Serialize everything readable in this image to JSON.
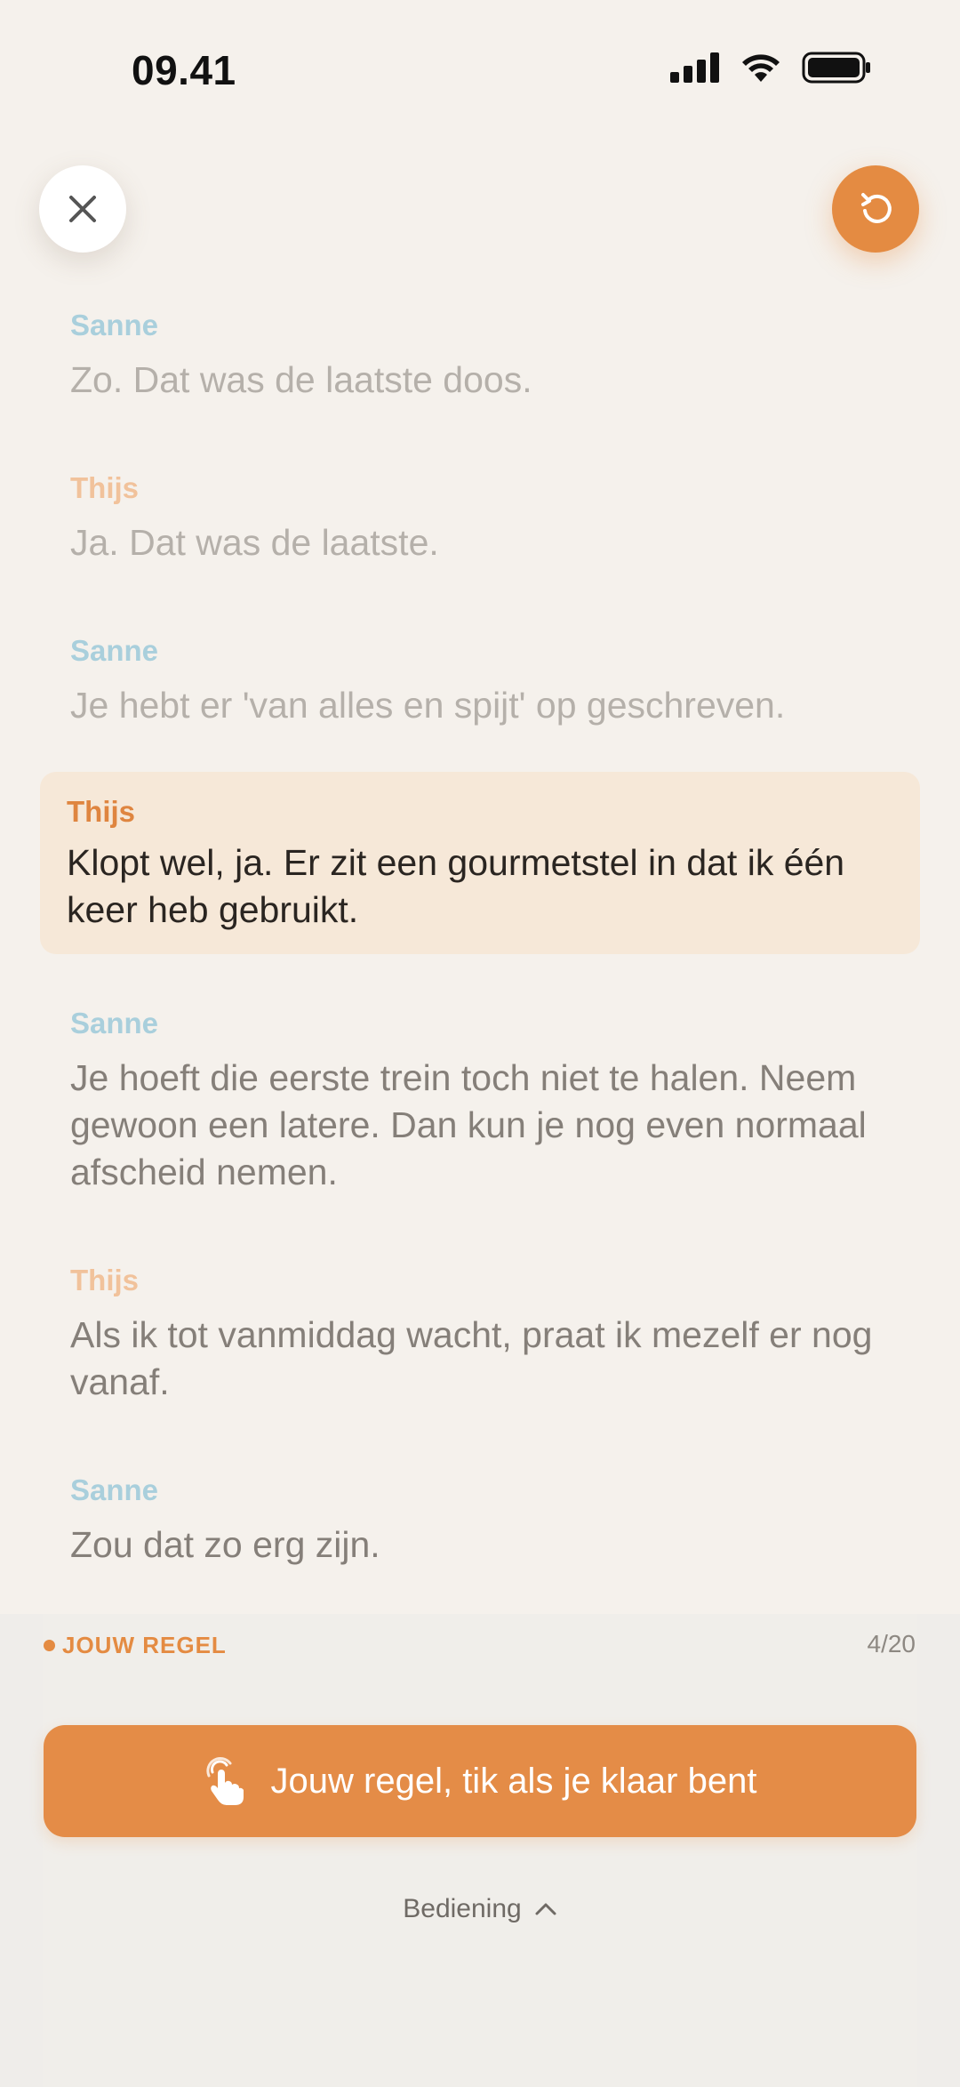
{
  "status_bar": {
    "time": "09.41"
  },
  "top_bar": {
    "close_icon": "close-icon",
    "restart_icon": "restart-icon"
  },
  "script_lines": [
    {
      "speaker": "Sanne",
      "text": "Zo. Dat was de laatste doos."
    },
    {
      "speaker": "Thijs",
      "text": "Ja. Dat was de laatste."
    },
    {
      "speaker": "Sanne",
      "text": "Je hebt er 'van alles en spijt' op geschreven."
    },
    {
      "speaker": "Thijs",
      "text": "Klopt wel, ja. Er zit een gourmetstel in dat ik één keer heb gebruikt."
    },
    {
      "speaker": "Sanne",
      "text": "Je hoeft die eerste trein toch niet te halen. Neem gewoon een latere. Dan kun je nog even normaal afscheid nemen."
    },
    {
      "speaker": "Thijs",
      "text": "Als ik tot vanmiddag wacht, praat ik mezelf er nog vanaf."
    },
    {
      "speaker": "Sanne",
      "text": "Zou dat zo erg zijn."
    }
  ],
  "bottom_panel": {
    "your_line_label": "JOUW REGEL",
    "counter": "4/20",
    "cue_button_label": "Jouw regel, tik als je klaar bent",
    "controls_label": "Bediening"
  },
  "colors": {
    "accent": "#e48b42",
    "sanne": "#a9cfdc",
    "thijs": "#f1c29b",
    "current_bg": "#f6e8d8"
  }
}
